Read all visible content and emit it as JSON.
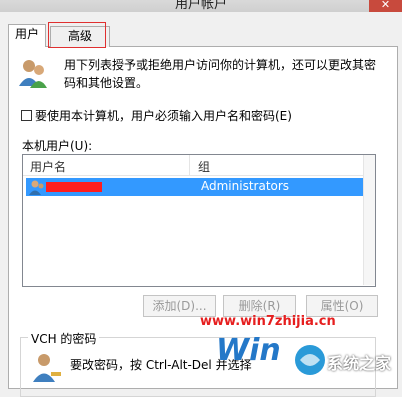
{
  "window": {
    "title": "用户帐户",
    "close_glyph": "✕"
  },
  "tabs": [
    {
      "label": "用户"
    },
    {
      "label": "高级"
    }
  ],
  "intro_text": "用下列表授予或拒绝用户访问你的计算机，还可以更改其密码和其他设置。",
  "require_login": {
    "label": "要使用本计算机，用户必须输入用户名和密码(E)",
    "checked": false
  },
  "users_list": {
    "label": "本机用户(U):",
    "columns": [
      "用户名",
      "组"
    ],
    "rows": [
      {
        "name": "",
        "group": "Administrators",
        "selected": true
      }
    ]
  },
  "buttons": {
    "add": "添加(D)...",
    "remove": "删除(R)",
    "properties": "属性(O)"
  },
  "password_group": {
    "title": "VCH 的密码",
    "text": "要改密码，按 Ctrl-Alt-Del 并选择"
  },
  "watermark": {
    "url": "www.win7zhijia.cn",
    "brand": "Win",
    "site": "系统之家"
  },
  "colors": {
    "selection": "#3399ff",
    "highlight_border": "#e03030",
    "close_button": "#c84a3d"
  },
  "icons": {
    "intro": "users-icon",
    "row": "user-icon",
    "password": "user-key-icon"
  }
}
